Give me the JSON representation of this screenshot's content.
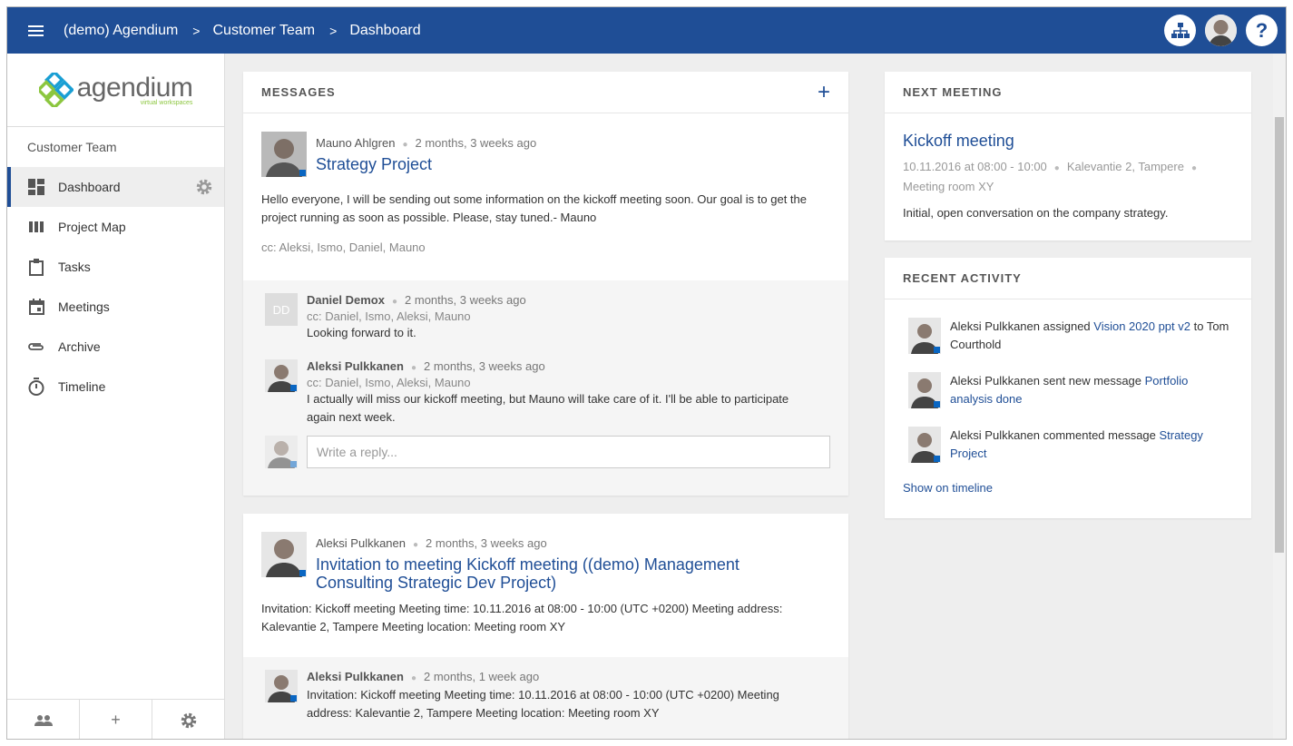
{
  "topbar": {
    "breadcrumb": [
      "(demo) Agendium",
      "Customer Team",
      "Dashboard"
    ],
    "sep": ">",
    "help_label": "?"
  },
  "sidebar": {
    "logo_text": "agendium",
    "logo_sub": "virtual workspaces",
    "team": "Customer Team",
    "items": [
      {
        "label": "Dashboard",
        "icon": "dashboard-icon"
      },
      {
        "label": "Project Map",
        "icon": "project-map-icon"
      },
      {
        "label": "Tasks",
        "icon": "clipboard-icon"
      },
      {
        "label": "Meetings",
        "icon": "calendar-icon"
      },
      {
        "label": "Archive",
        "icon": "paperclip-icon"
      },
      {
        "label": "Timeline",
        "icon": "stopwatch-icon"
      }
    ],
    "bottom_plus": "+"
  },
  "messages": {
    "heading": "MESSAGES",
    "add_label": "+",
    "posts": [
      {
        "author": "Mauno Ahlgren",
        "time": "2 months, 3 weeks ago",
        "title": "Strategy Project",
        "body": "Hello everyone, I will be sending out some information on the kickoff meeting soon. Our goal is to get the project running as soon as possible. Please, stay tuned.- Mauno",
        "cc": "cc: Aleksi, Ismo, Daniel, Mauno",
        "replies": [
          {
            "initials": "DD",
            "author": "Daniel Demox",
            "time": "2 months, 3 weeks ago",
            "cc": "cc: Daniel, Ismo, Aleksi, Mauno",
            "body": "Looking forward to it."
          },
          {
            "author": "Aleksi Pulkkanen",
            "time": "2 months, 3 weeks ago",
            "cc": "cc: Daniel, Ismo, Aleksi, Mauno",
            "body": "I actually will miss our kickoff meeting, but Mauno will take care of it. I'll be able to participate again next week."
          }
        ],
        "reply_placeholder": "Write a reply..."
      },
      {
        "author": "Aleksi Pulkkanen",
        "time": "2 months, 3 weeks ago",
        "title": "Invitation to meeting Kickoff meeting ((demo) Management Consulting Strategic Dev Project)",
        "body": "Invitation: Kickoff meeting Meeting time: 10.11.2016 at 08:00 - 10:00 (UTC +0200) Meeting address: Kalevantie 2, Tampere Meeting location: Meeting room XY",
        "replies": [
          {
            "author": "Aleksi Pulkkanen",
            "time": "2 months, 1 week ago",
            "body": "Invitation: Kickoff meeting Meeting time: 10.11.2016 at 08:00 - 10:00 (UTC +0200) Meeting address: Kalevantie 2, Tampere Meeting location: Meeting room XY"
          }
        ]
      }
    ]
  },
  "next_meeting": {
    "heading": "NEXT MEETING",
    "title": "Kickoff meeting",
    "datetime": "10.11.2016 at 08:00 - 10:00",
    "address": "Kalevantie 2, Tampere",
    "room": "Meeting room XY",
    "description": "Initial, open conversation on the company strategy."
  },
  "recent_activity": {
    "heading": "RECENT ACTIVITY",
    "items": [
      {
        "text": "Aleksi Pulkkanen assigned ",
        "link": "Vision 2020 ppt v2",
        "after": " to Tom Courthold"
      },
      {
        "text": "Aleksi Pulkkanen sent new message ",
        "link": "Portfolio analysis done",
        "after": ""
      },
      {
        "text": "Aleksi Pulkkanen commented message ",
        "link": "Strategy Project",
        "after": ""
      }
    ],
    "show_more": "Show on timeline"
  },
  "colors": {
    "primary": "#1f4e96",
    "linkedin": "#0a66c2",
    "logo_green": "#8cc63f"
  }
}
